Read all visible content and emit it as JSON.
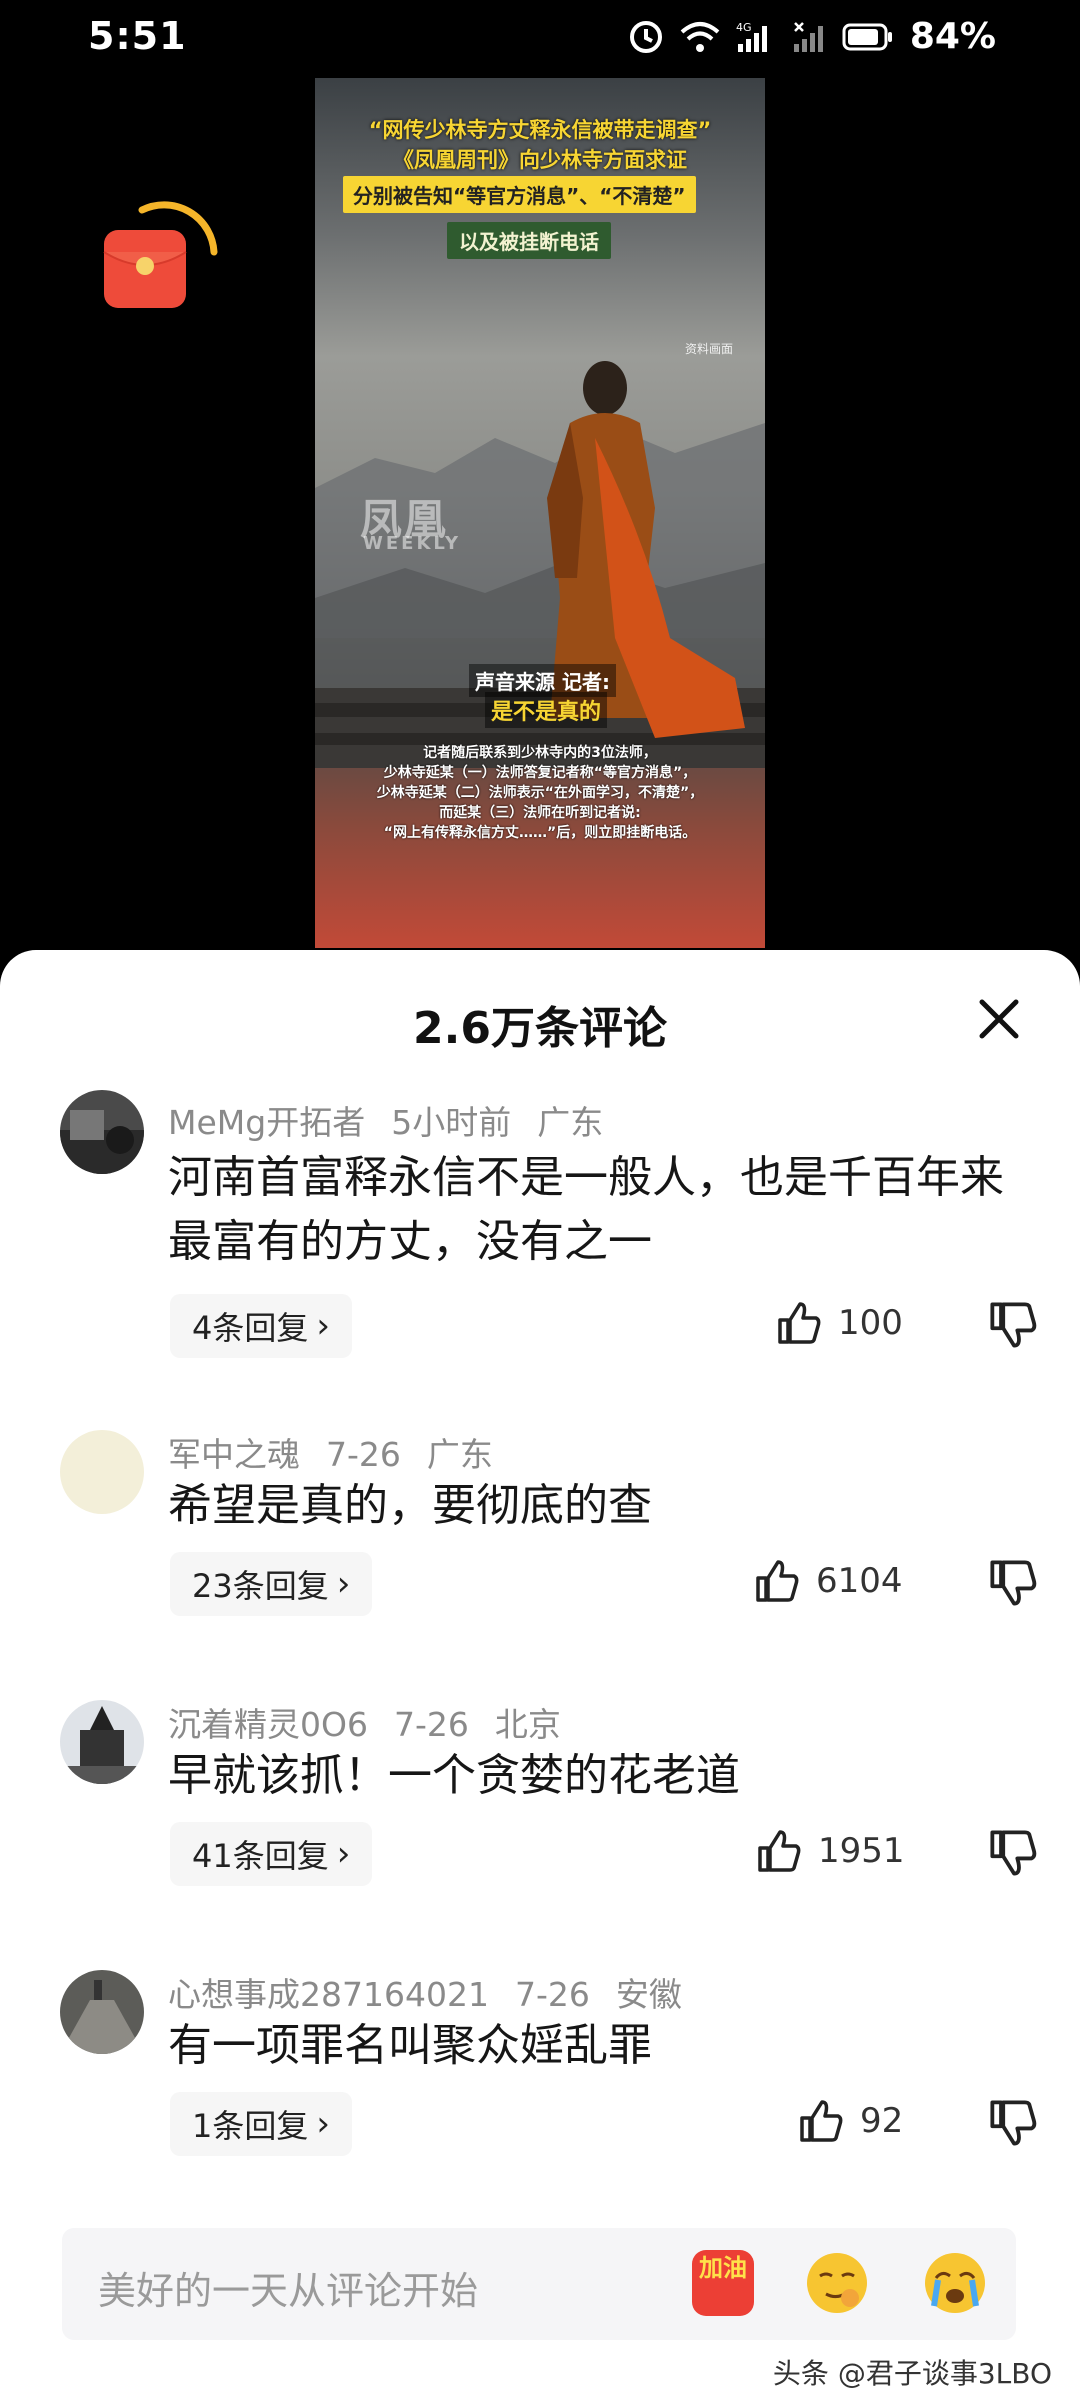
{
  "status_bar": {
    "time": "5:51",
    "battery": "84%"
  },
  "video": {
    "caption_line1": "“网传少林寺方丈释永信被带走调查”",
    "caption_line2": "《凤凰周刊》向少林寺方面求证",
    "caption_line3": "分别被告知“等官方消息”、“不清楚”",
    "caption_line4": "以及被挂断电话",
    "source_tag": "资料画面",
    "watermark_title": "凤凰",
    "watermark_sub": "WEEKLY",
    "voice_label": "声音来源 记者:",
    "voice_quote": "是不是真的",
    "subtitles": [
      "记者随后联系到少林寺内的3位法师，",
      "少林寺延某（一）法师答复记者称“等官方消息”，",
      "少林寺延某（二）法师表示“在外面学习，不清楚”，",
      "而延某（三）法师在听到记者说:",
      "“网上有传释永信方丈……”后，则立即挂断电话。"
    ]
  },
  "sheet": {
    "title": "2.6万条评论"
  },
  "comments": [
    {
      "user": "MeMg开拓者",
      "time": "5小时前",
      "location": "广东",
      "text": "河南首富释永信不是一般人，也是千百年来最富有的方丈，没有之一",
      "replies": "4条回复",
      "likes": "100"
    },
    {
      "user": "军中之魂",
      "time": "7-26",
      "location": "广东",
      "text": "希望是真的，要彻底的查",
      "replies": "23条回复",
      "likes": "6104"
    },
    {
      "user": "沉着精灵0O6",
      "time": "7-26",
      "location": "北京",
      "text": "早就该抓！一个贪婪的花老道",
      "replies": "41条回复",
      "likes": "1951"
    },
    {
      "user": "心想事成287164021",
      "time": "7-26",
      "location": "安徽",
      "text": "有一项罪名叫聚众婬乱罪",
      "replies": "1条回复",
      "likes": "92"
    }
  ],
  "input": {
    "placeholder": "美好的一天从评论开始",
    "sticker_text": "加油"
  },
  "watermark": "头条 @君子谈事3LBO"
}
